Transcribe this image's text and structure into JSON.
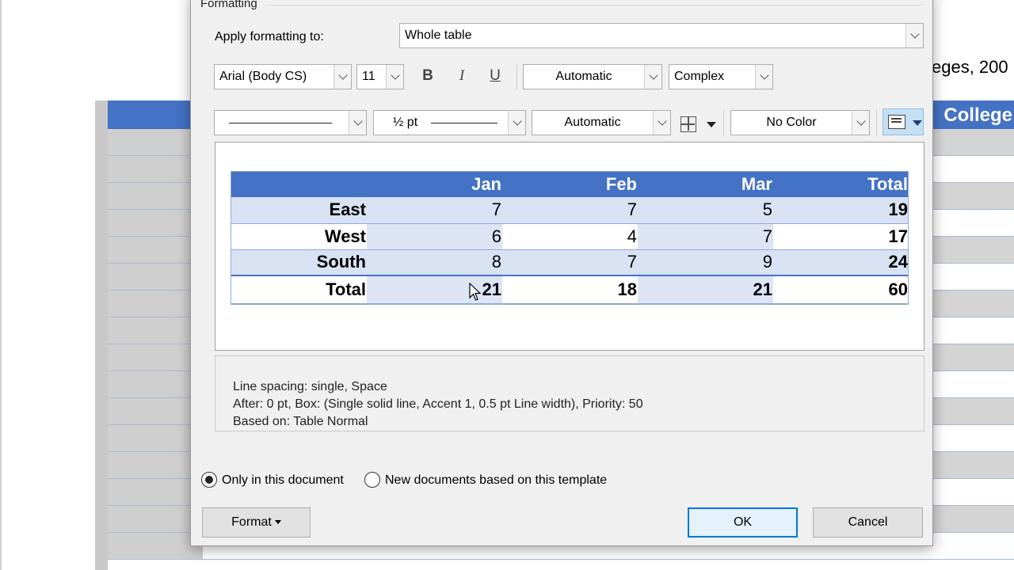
{
  "background_document": {
    "title_fragment": "eges, 200",
    "header_fragment": "College"
  },
  "dialog": {
    "group_title": "Formatting",
    "apply_label": "Apply formatting to:",
    "apply_value": "Whole table",
    "font_name": "Arial (Body CS)",
    "font_size": "11",
    "bold_glyph": "B",
    "italic_glyph": "I",
    "underline_glyph": "U",
    "font_color": "Automatic",
    "script": "Complex",
    "border_width": "½ pt",
    "border_color": "Automatic",
    "shading": "No Color",
    "description": {
      "line1": "Line spacing:  single, Space",
      "line2": "After:  0 pt, Box: (Single solid line, Accent 1,  0.5 pt Line width), Priority: 50",
      "line3": "Based on: Table Normal"
    },
    "radio_only_doc": "Only in this document",
    "radio_new_docs": "New documents based on this template",
    "format_button": "Format",
    "ok_button": "OK",
    "cancel_button": "Cancel"
  },
  "preview_table": {
    "headers": [
      "",
      "Jan",
      "Feb",
      "Mar",
      "Total"
    ],
    "rows": [
      {
        "label": "East",
        "jan": "7",
        "feb": "7",
        "mar": "5",
        "total": "19"
      },
      {
        "label": "West",
        "jan": "6",
        "feb": "4",
        "mar": "7",
        "total": "17"
      },
      {
        "label": "South",
        "jan": "8",
        "feb": "7",
        "mar": "9",
        "total": "24"
      }
    ],
    "total_row": {
      "label": "Total",
      "jan": "21",
      "feb": "18",
      "mar": "21",
      "total": "60"
    }
  },
  "colors": {
    "accent": "#4472c4",
    "band": "#d9e2f3",
    "ok_focus": "#0078d7"
  }
}
